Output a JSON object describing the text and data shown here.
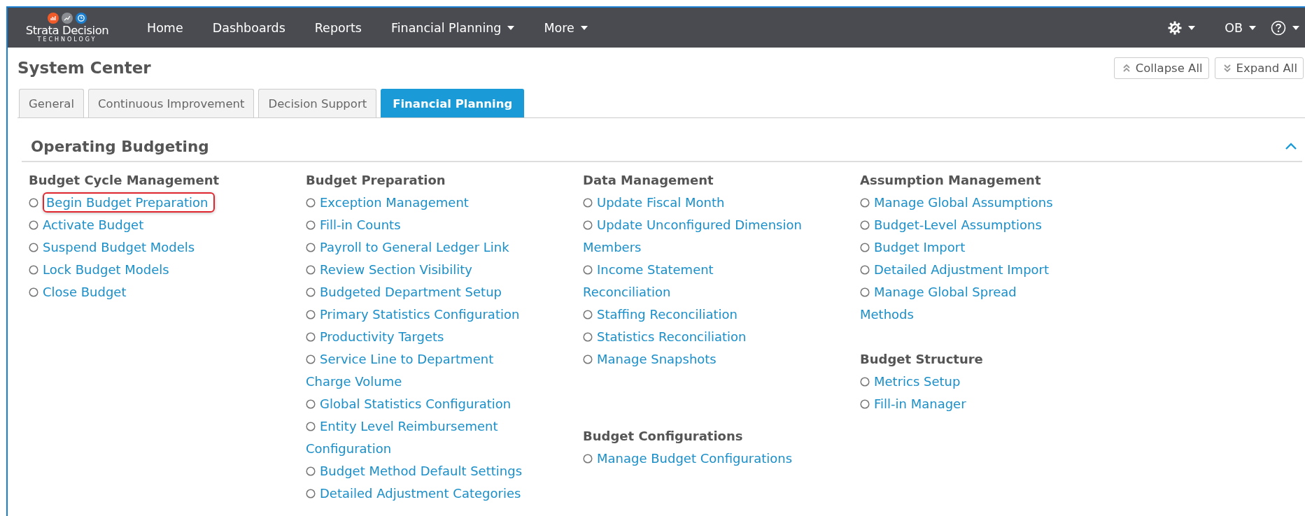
{
  "nav": {
    "logo": {
      "name": "Strata Decision",
      "tagline": "TECHNOLOGY"
    },
    "items": [
      {
        "label": "Home",
        "dropdown": false
      },
      {
        "label": "Dashboards",
        "dropdown": false
      },
      {
        "label": "Reports",
        "dropdown": false
      },
      {
        "label": "Financial Planning",
        "dropdown": true
      },
      {
        "label": "More",
        "dropdown": true
      }
    ],
    "user": "OB"
  },
  "page": {
    "title": "System Center",
    "buttons": [
      {
        "label": "Collapse All",
        "kind": "collapse"
      },
      {
        "label": "Expand All",
        "kind": "expand"
      }
    ],
    "tabs": [
      {
        "label": "General",
        "selected": false
      },
      {
        "label": "Continuous Improvement",
        "selected": false
      },
      {
        "label": "Decision Support",
        "selected": false
      },
      {
        "label": "Financial Planning",
        "selected": true
      }
    ]
  },
  "section": {
    "title": "Operating Budgeting",
    "expanded": true,
    "columns": [
      {
        "groups": [
          {
            "title": "Budget Cycle Management",
            "links": [
              {
                "label": "Begin Budget Preparation",
                "highlighted": true
              },
              {
                "label": "Activate Budget",
                "highlighted": false
              },
              {
                "label": "Suspend Budget Models",
                "highlighted": false
              },
              {
                "label": "Lock Budget Models",
                "highlighted": false
              },
              {
                "label": "Close Budget",
                "highlighted": false
              }
            ]
          }
        ]
      },
      {
        "groups": [
          {
            "title": "Budget Preparation",
            "links": [
              {
                "label": "Exception Management",
                "highlighted": false
              },
              {
                "label": "Fill-in Counts",
                "highlighted": false
              },
              {
                "label": "Payroll to General Ledger Link",
                "highlighted": false
              },
              {
                "label": "Review Section Visibility",
                "highlighted": false
              },
              {
                "label": "Budgeted Department Setup",
                "highlighted": false
              },
              {
                "label": "Primary Statistics Configuration",
                "highlighted": false
              },
              {
                "label": "Productivity Targets",
                "highlighted": false
              },
              {
                "label": "Service Line to Department Charge Volume",
                "highlighted": false
              },
              {
                "label": "Global Statistics Configuration",
                "highlighted": false
              },
              {
                "label": "Entity Level Reimbursement Configuration",
                "highlighted": false
              },
              {
                "label": "Budget Method Default Settings",
                "highlighted": false
              },
              {
                "label": "Detailed Adjustment Categories",
                "highlighted": false
              }
            ]
          }
        ]
      },
      {
        "groups": [
          {
            "title": "Data Management",
            "links": [
              {
                "label": "Update Fiscal Month",
                "highlighted": false
              },
              {
                "label": "Update Unconfigured Dimension Members",
                "highlighted": false
              },
              {
                "label": "Income Statement Reconciliation",
                "highlighted": false
              },
              {
                "label": "Staffing Reconciliation",
                "highlighted": false
              },
              {
                "label": "Statistics Reconciliation",
                "highlighted": false
              },
              {
                "label": "Manage Snapshots",
                "highlighted": false
              }
            ]
          },
          {
            "title": "Budget Configurations",
            "links": [
              {
                "label": "Manage Budget Configurations",
                "highlighted": false
              }
            ]
          }
        ]
      },
      {
        "groups": [
          {
            "title": "Assumption Management",
            "links": [
              {
                "label": "Manage Global Assumptions",
                "highlighted": false
              },
              {
                "label": "Budget-Level Assumptions",
                "highlighted": false
              },
              {
                "label": "Budget Import",
                "highlighted": false
              },
              {
                "label": "Detailed Adjustment Import",
                "highlighted": false
              },
              {
                "label": "Manage Global Spread Methods",
                "highlighted": false
              }
            ]
          },
          {
            "title": "Budget Structure",
            "links": [
              {
                "label": "Metrics Setup",
                "highlighted": false
              },
              {
                "label": "Fill-in Manager",
                "highlighted": false
              }
            ]
          }
        ]
      }
    ]
  }
}
